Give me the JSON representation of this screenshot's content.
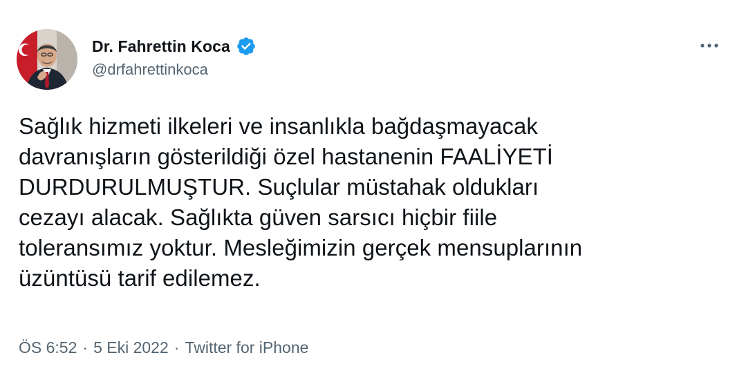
{
  "user": {
    "display_name": "Dr. Fahrettin Koca",
    "handle": "@drfahrettinkoca",
    "verified": true,
    "avatar_icon": "profile-photo"
  },
  "menu": {
    "icon": "more-dots-icon"
  },
  "tweet": {
    "text": "Sağlık hizmeti ilkeleri ve insanlıkla bağdaşmayacak\ndavranışların gösterildiği özel hastanenin FAALİYETİ\nDURDURULMUŞTUR. Suçlular müstahak oldukları\ncezayı alacak. Sağlıkta güven sarsıcı hiçbir fiile\ntoleransımız yoktur. Mesleğimizin gerçek mensuplarının\nüzüntüsü tarif edilemez."
  },
  "meta": {
    "time": "ÖS 6:52",
    "separator": "·",
    "date": "5 Eki 2022",
    "source": "Twitter for iPhone"
  },
  "colors": {
    "text": "#0f1419",
    "secondary": "#536471",
    "verified": "#1d9bf0"
  }
}
